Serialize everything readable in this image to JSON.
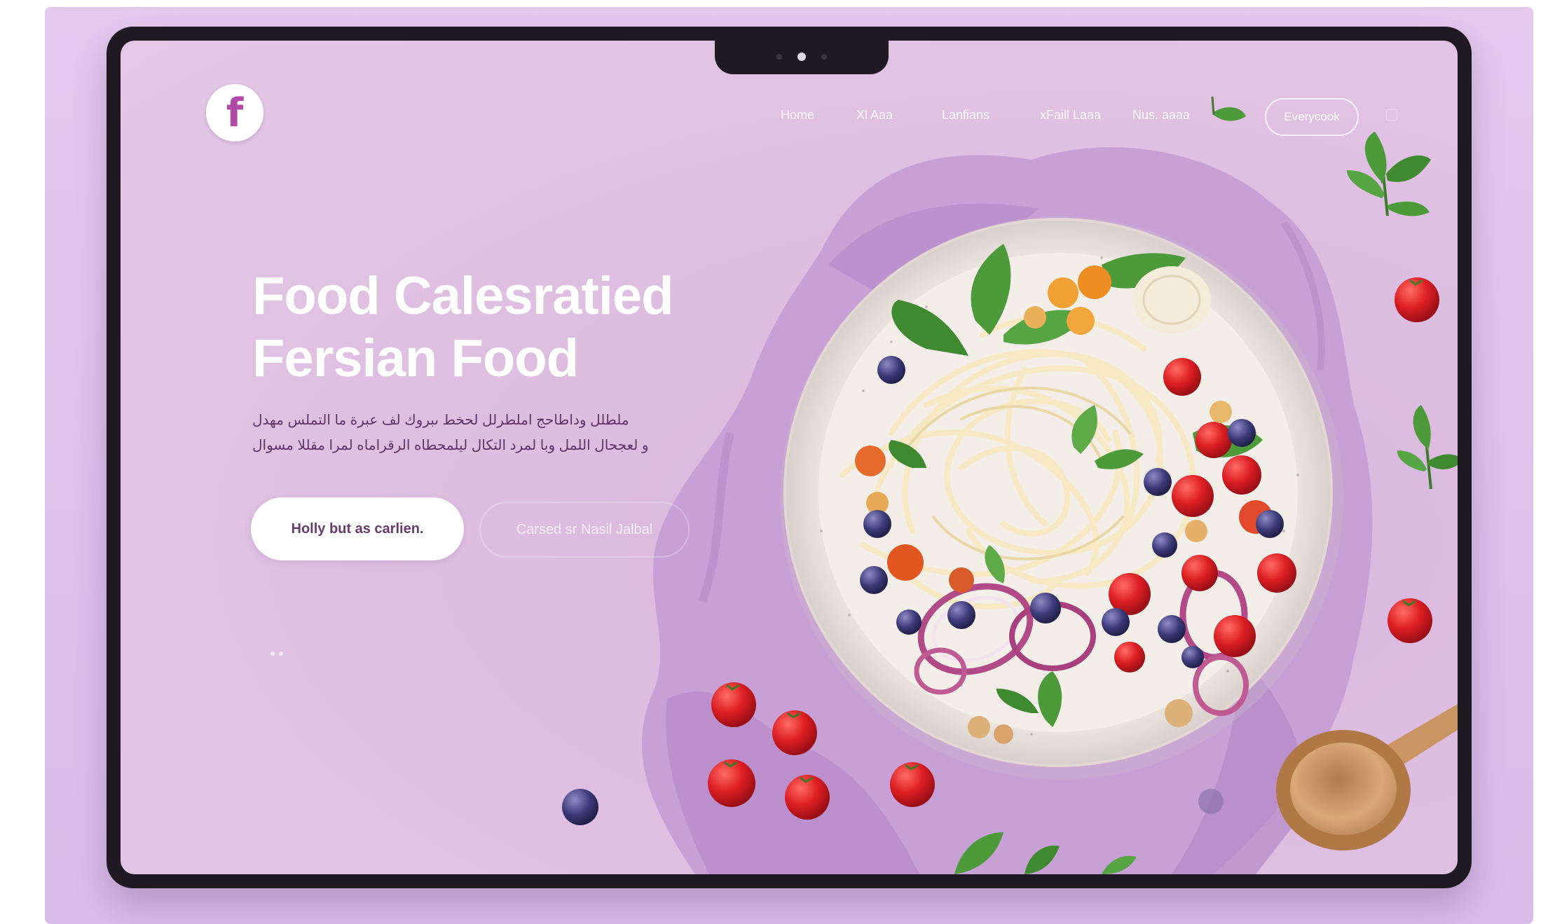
{
  "brand": {
    "logo_letter": "f"
  },
  "nav": {
    "items": [
      "Home",
      "Xl Aaa",
      "Lanfians",
      "xFaill Laaa",
      "Nus. aaaa"
    ],
    "cta_label": "Everycook"
  },
  "hero": {
    "title_lines": [
      "Food Calesratied",
      "Fersian Food"
    ],
    "description_lines": [
      "ملطلل وداطاحج املطرلل لحخط ىبروك لف عبرة ما التملس مهدل",
      "و لعجحال اللمل وبا لمرد التكال ليلمحطاه الرقراماه لمرا مقللا مسوال"
    ],
    "primary_button": "Holly but as carlien.",
    "secondary_button": "Carsed sr Nasil Jalbal"
  },
  "colors": {
    "background": "#dcc1ea",
    "screen": "#ddbde0",
    "device_frame": "#1f1a22",
    "logo_accent": "#b04aa6",
    "text_light": "#ffffff",
    "text_dark": "#5e3566"
  }
}
